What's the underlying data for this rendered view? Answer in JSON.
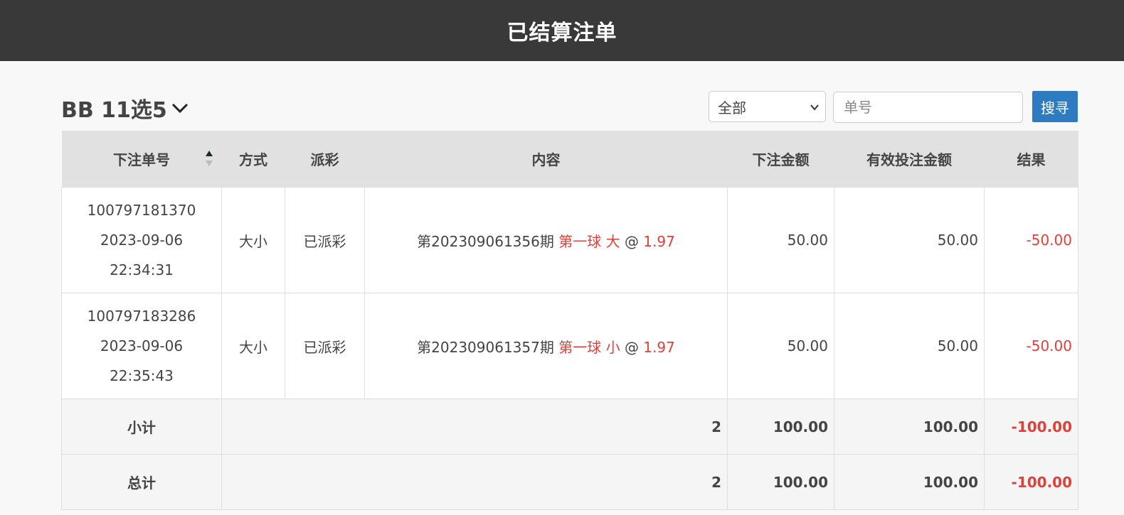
{
  "header": {
    "title": "已结算注单"
  },
  "toolbar": {
    "game_name": "BB 11选5",
    "filter_selected": "全部",
    "search_placeholder": "单号",
    "search_button": "搜寻"
  },
  "table": {
    "columns": [
      "下注单号",
      "方式",
      "派彩",
      "内容",
      "下注金额",
      "有效投注金额",
      "结果"
    ],
    "rows": [
      {
        "id": "100797181370",
        "date": "2023-09-06",
        "time": "22:34:31",
        "method": "大小",
        "payout": "已派彩",
        "period": "第202309061356期",
        "bet": "第一球 大",
        "at": "@",
        "odds": "1.97",
        "amount": "50.00",
        "valid": "50.00",
        "result": "-50.00"
      },
      {
        "id": "100797183286",
        "date": "2023-09-06",
        "time": "22:35:43",
        "method": "大小",
        "payout": "已派彩",
        "period": "第202309061357期",
        "bet": "第一球 小",
        "at": "@",
        "odds": "1.97",
        "amount": "50.00",
        "valid": "50.00",
        "result": "-50.00"
      }
    ],
    "subtotal": {
      "label": "小计",
      "count": "2",
      "amount": "100.00",
      "valid": "100.00",
      "result": "-100.00"
    },
    "total": {
      "label": "总计",
      "count": "2",
      "amount": "100.00",
      "valid": "100.00",
      "result": "-100.00"
    }
  },
  "colors": {
    "header_bg": "#393939",
    "accent": "#2f7bc2",
    "negative": "#e0403a"
  },
  "icons": {
    "game_dropdown": "chevron-down-icon",
    "filter_dropdown": "chevron-down-icon",
    "sort": "sort-icon"
  }
}
